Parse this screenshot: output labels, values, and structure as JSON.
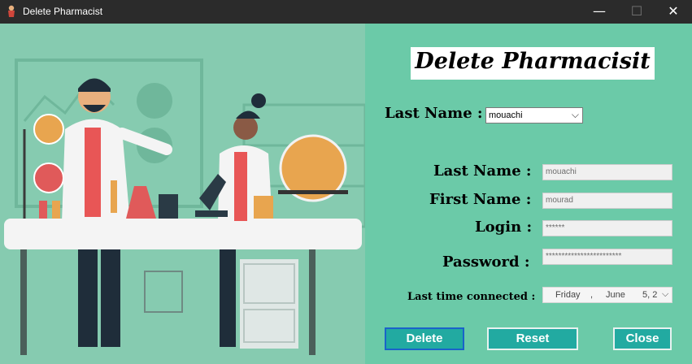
{
  "window": {
    "title": "Delete Pharmacist",
    "min_glyph": "—",
    "max_glyph": "☐",
    "close_glyph": "✕"
  },
  "form": {
    "heading": "Delete Pharmacisit",
    "select_label": "Last Name :",
    "select_value": "mouachi",
    "fields": {
      "last_name_label": "Last Name :",
      "last_name_value": "mouachi",
      "first_name_label": "First Name :",
      "first_name_value": "mourad",
      "login_label": "Login :",
      "login_value": "******",
      "password_label": "Password :",
      "password_value": "************************"
    },
    "last_connected_label": "Last time connected :",
    "date": {
      "day": "Friday",
      "sep": ",",
      "month": "June",
      "date": "5, 2"
    }
  },
  "buttons": {
    "delete": "Delete",
    "reset": "Reset",
    "close": "Close"
  },
  "colors": {
    "panel": "#6bcaa8",
    "button": "#22aaa1",
    "title_bar": "#2b2b2b"
  }
}
